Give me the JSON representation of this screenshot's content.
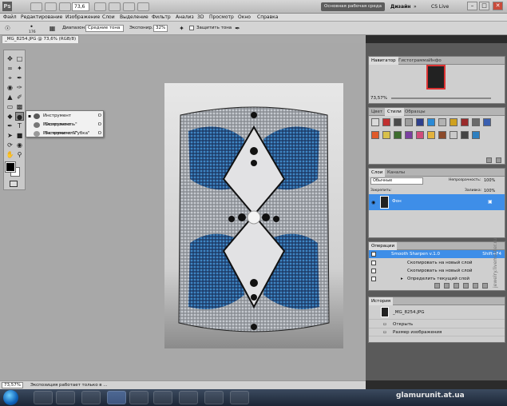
{
  "app": {
    "logo": "Ps",
    "zoom": "73,6",
    "workspace_active": "Основная рабочая среда",
    "workspace_design": "Дизайн",
    "workspace_more": "»",
    "cslive": "CS Live",
    "minimize": "–",
    "maximize": "□",
    "close": "✕"
  },
  "menu": [
    "Файл",
    "Редактирование",
    "Изображение",
    "Слои",
    "Выделение",
    "Фильтр",
    "Анализ",
    "3D",
    "Просмотр",
    "Окно",
    "Справка"
  ],
  "options": {
    "brush_size": "176",
    "range_label": "Диапазон:",
    "range_value": "Средние тона",
    "exposure_label": "Экспонир.:",
    "exposure_value": "32%",
    "protect_tones": "Защитить тона"
  },
  "document": {
    "tab": "_MG_8254.JPG @ 73,6% (RGB/8) *",
    "zoom_status": "73,57%",
    "status_text": "Экспозиция работает только в ..."
  },
  "tool_flyout": [
    {
      "label": "Инструмент \"Осветлитель\"",
      "key": "O",
      "active": true
    },
    {
      "label": "Инструмент \"Затемнитель\"",
      "key": "O",
      "active": false
    },
    {
      "label": "Инструмент \"Губка\"",
      "key": "O",
      "active": false
    }
  ],
  "navigator": {
    "tabs": [
      "Навигатор",
      "Гистограмма",
      "Инфо"
    ],
    "zoom": "73,57%"
  },
  "styles": {
    "tabs": [
      "Цвет",
      "Стили",
      "Образцы"
    ]
  },
  "layers": {
    "tabs": [
      "Слои",
      "Каналы"
    ],
    "blend": "Обычные",
    "opacity_label": "Непрозрачность:",
    "opacity": "100%",
    "lock_label": "Закрепить:",
    "fill_label": "Заливка:",
    "fill": "100%",
    "layer_name": "Фон"
  },
  "actions": {
    "tab": "Операции",
    "set_name": "Smooth Sharpen v.1.0",
    "shortcut": "Shift+F4",
    "items": [
      "Скопировать на новый слой",
      "Скопировать на новый слой",
      "Определить текущий слой"
    ]
  },
  "history": {
    "tab": "История",
    "snapshot": "_MG_8254.JPG",
    "items": [
      "Открыть",
      "Размер изображения"
    ]
  },
  "watermark": "glamurunit.at.ua",
  "side_watermark": "jewelry.livemaster.ru",
  "colors": {
    "layer_selected": "#3e8ee8",
    "canvas_bg": "#a8a8a8",
    "panel_bg": "#cfcfcf"
  }
}
